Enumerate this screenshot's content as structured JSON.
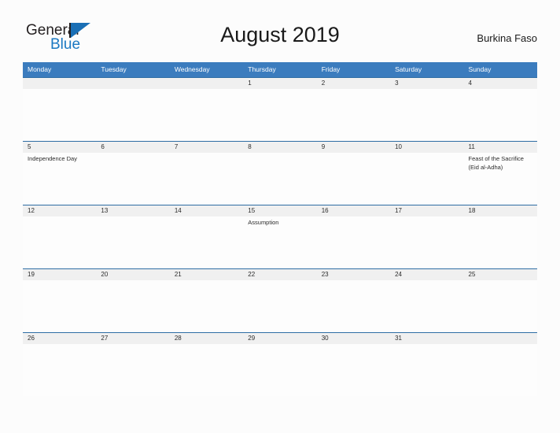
{
  "brand": {
    "name_part1": "General",
    "name_part2": "Blue",
    "logo_icon": "blue-triangle-logo",
    "accent_color": "#1a78c2"
  },
  "header": {
    "title": "August 2019",
    "country": "Burkina Faso",
    "month": "August",
    "year": "2019"
  },
  "theme": {
    "header_row_color": "#3b7cbe",
    "date_band_color": "#f0f0f0",
    "row_divider_color": "#2e6da4",
    "page_background": "#fcfcfc",
    "text_color": "#2b2b2b"
  },
  "calendar": {
    "weekday_headers": [
      "Monday",
      "Tuesday",
      "Wednesday",
      "Thursday",
      "Friday",
      "Saturday",
      "Sunday"
    ],
    "weeks": [
      {
        "days": [
          {
            "date": "",
            "event": ""
          },
          {
            "date": "",
            "event": ""
          },
          {
            "date": "",
            "event": ""
          },
          {
            "date": "1",
            "event": ""
          },
          {
            "date": "2",
            "event": ""
          },
          {
            "date": "3",
            "event": ""
          },
          {
            "date": "4",
            "event": ""
          }
        ]
      },
      {
        "days": [
          {
            "date": "5",
            "event": "Independence Day"
          },
          {
            "date": "6",
            "event": ""
          },
          {
            "date": "7",
            "event": ""
          },
          {
            "date": "8",
            "event": ""
          },
          {
            "date": "9",
            "event": ""
          },
          {
            "date": "10",
            "event": ""
          },
          {
            "date": "11",
            "event": "Feast of the Sacrifice (Eid al-Adha)"
          }
        ]
      },
      {
        "days": [
          {
            "date": "12",
            "event": ""
          },
          {
            "date": "13",
            "event": ""
          },
          {
            "date": "14",
            "event": ""
          },
          {
            "date": "15",
            "event": "Assumption"
          },
          {
            "date": "16",
            "event": ""
          },
          {
            "date": "17",
            "event": ""
          },
          {
            "date": "18",
            "event": ""
          }
        ]
      },
      {
        "days": [
          {
            "date": "19",
            "event": ""
          },
          {
            "date": "20",
            "event": ""
          },
          {
            "date": "21",
            "event": ""
          },
          {
            "date": "22",
            "event": ""
          },
          {
            "date": "23",
            "event": ""
          },
          {
            "date": "24",
            "event": ""
          },
          {
            "date": "25",
            "event": ""
          }
        ]
      },
      {
        "days": [
          {
            "date": "26",
            "event": ""
          },
          {
            "date": "27",
            "event": ""
          },
          {
            "date": "28",
            "event": ""
          },
          {
            "date": "29",
            "event": ""
          },
          {
            "date": "30",
            "event": ""
          },
          {
            "date": "31",
            "event": ""
          },
          {
            "date": "",
            "event": ""
          }
        ]
      }
    ]
  }
}
